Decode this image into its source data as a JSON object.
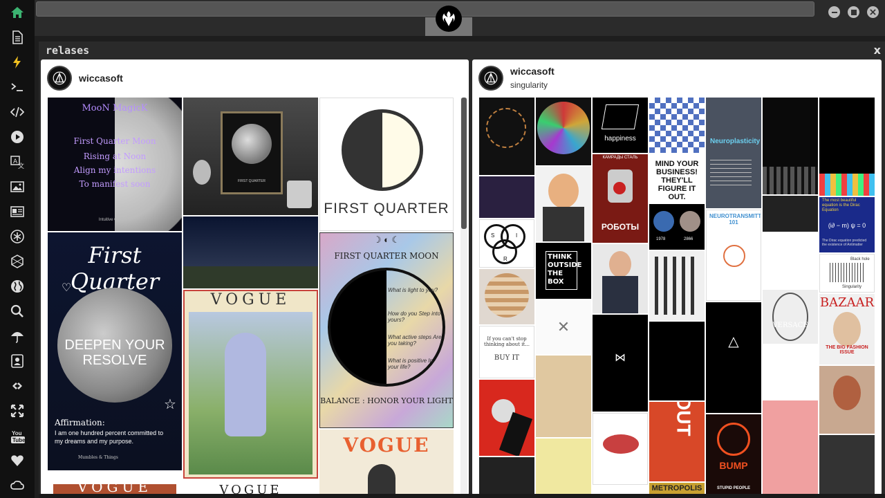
{
  "sidebar": {
    "icons": [
      "home-icon",
      "document-icon",
      "lightning-icon",
      "terminal-icon",
      "code-icon",
      "play-icon",
      "translate-icon",
      "image-icon",
      "news-icon",
      "asterisk-icon",
      "hexagon-icon",
      "globe-icon",
      "search-icon",
      "umbrella-icon",
      "contacts-icon",
      "link-icon",
      "expand-icon",
      "youtube-icon",
      "heart-icon",
      "cloud-icon"
    ],
    "youtube_label": "YouTube",
    "active_color": "#3cb371"
  },
  "panel": {
    "title": "relases",
    "close_label": "x"
  },
  "left_card": {
    "username": "wiccasoft",
    "tiles": {
      "moon_magick": {
        "title": "MooN MagicK",
        "lines": [
          "First Quarter Moon",
          "Rising at Noon",
          "Align my intentions",
          "To manifest soon"
        ],
        "footer": "Intuitive Goddess"
      },
      "poster_frame": {
        "caption": "FIRST QUARTER"
      },
      "first_quarter_symbol": {
        "label": "FIRST QUARTER"
      },
      "deepen": {
        "script": "First Quarter",
        "headline": "DEEPEN YOUR RESOLVE",
        "affirmation_title": "Affirmation:",
        "affirmation_text": "I am one hundred percent committed to my dreams and my purpose.",
        "credit": "Mumbles & Things"
      },
      "vogue1": {
        "title": "VOGUE"
      },
      "fq_moon": {
        "title": "FIRST QUARTER MOON",
        "questions": [
          "What is light to you?",
          "How do you Step into yours?",
          "What active steps Are you taking?",
          "What is positive In your life?"
        ],
        "footer": "BALANCE : HONOR YOUR LIGHT"
      },
      "vogue2": {
        "title": "VOGUE"
      },
      "vogue3": {
        "title": "VOGUE"
      },
      "vogue4": {
        "title": "VOGUE"
      }
    }
  },
  "right_card": {
    "username": "wiccasoft",
    "subtitle": "singularity",
    "tiles": {
      "happiness": {
        "label": "happiness"
      },
      "neuroplasticity": {
        "title": "Neuroplasticity"
      },
      "mind_your_business": {
        "text": "MIND YOUR BUSINESS! THEY'LL FIGURE IT OUT."
      },
      "robots": {
        "header": "КАМРАДЫ СТАЛЬ",
        "title": "РОБОТЫ"
      },
      "planets": {
        "left": "1978",
        "right": "2866"
      },
      "neurotransmitters": {
        "title": "NEUROTRANSMITTERS 101"
      },
      "dirac": {
        "line1": "The most beautiful equation is the Dirac Equation",
        "equation": "(i∂ − m) ψ = 0",
        "line2": "The Dirac equation predicted the existence of Antimatter"
      },
      "black_hole": {
        "title": "Black hole",
        "caption": "Singularity"
      },
      "think_outside": {
        "text": "THINK OUTSIDE THE BOX"
      },
      "buy_it": {
        "line1": "If you can't stop thinking about it...",
        "line2": "BUY IT"
      },
      "versace": {
        "title": "VERSACE"
      },
      "bazaar": {
        "title": "BAZAAR",
        "subtitle": "THE BIG FASHION ISSUE"
      },
      "metropolis": {
        "title": "METROPOLIS"
      },
      "bump": {
        "title": "BUMP"
      },
      "out": {
        "title": "OUT"
      },
      "stupid_people": {
        "title": "STUPID PEOPLE"
      },
      "sir": {
        "s": "S",
        "i": "I",
        "r": "R"
      }
    }
  }
}
